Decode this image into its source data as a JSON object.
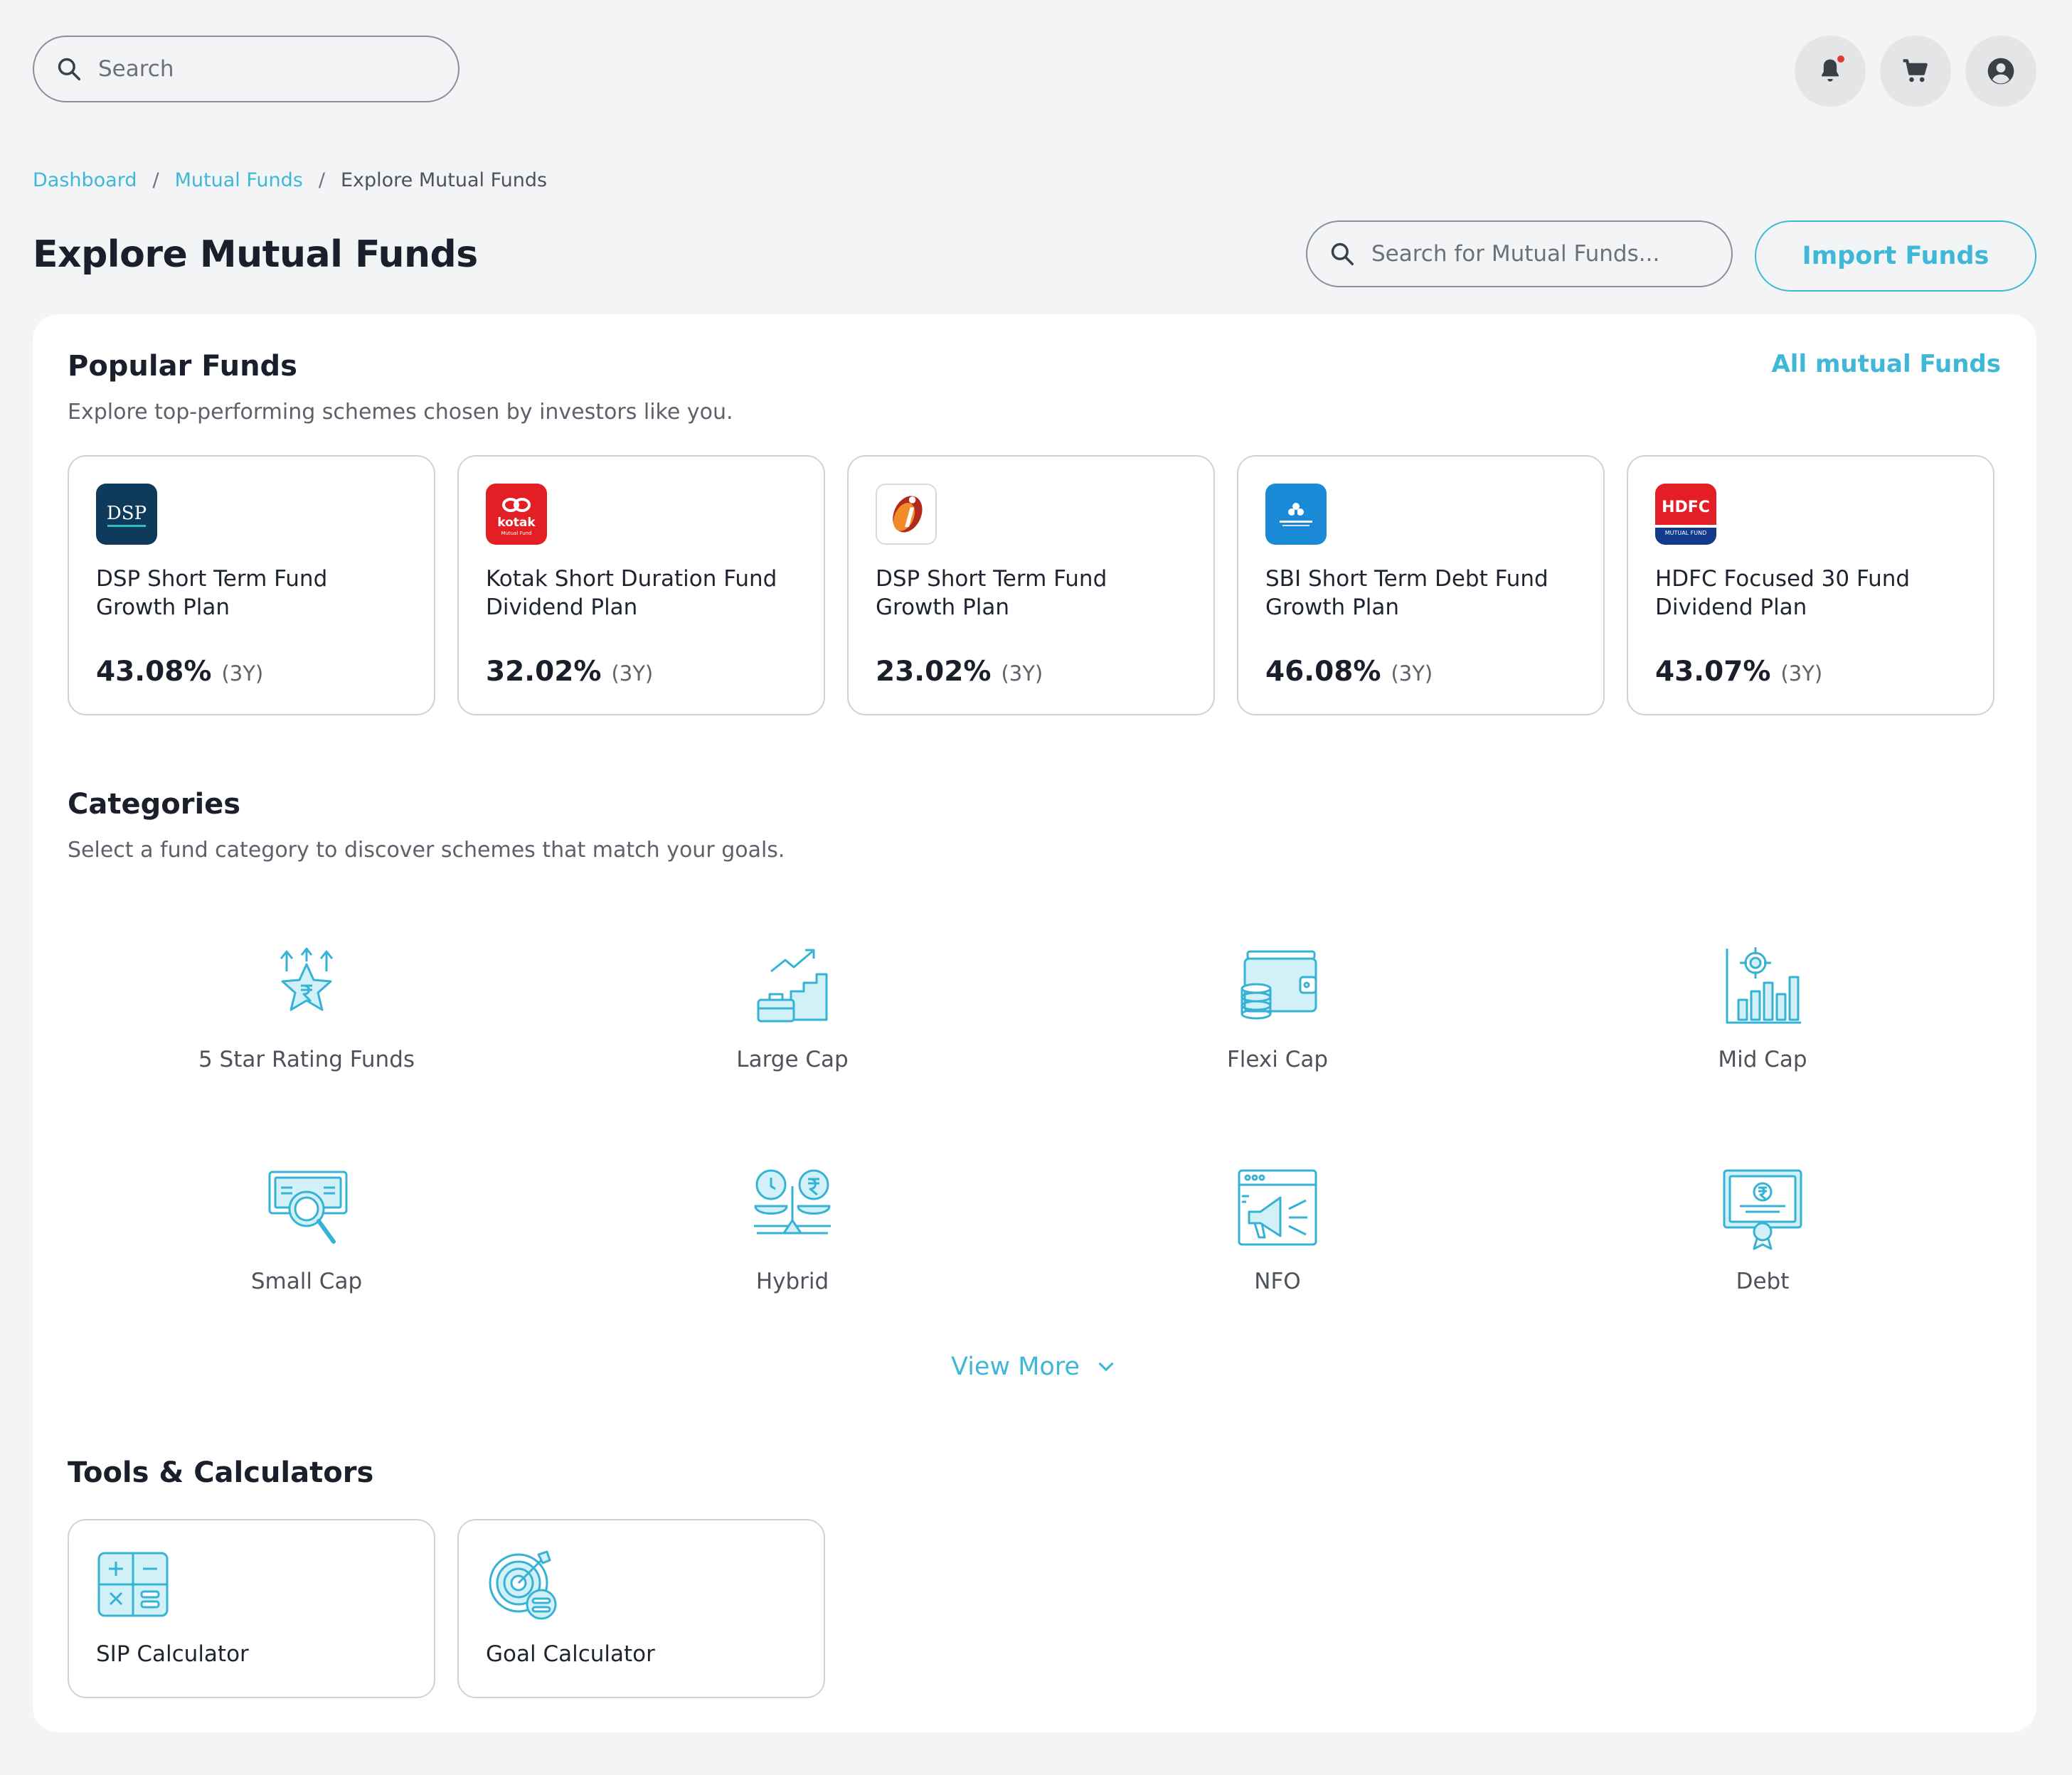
{
  "header": {
    "search_placeholder": "Search",
    "icons": [
      "bell-icon",
      "cart-icon",
      "user-icon"
    ]
  },
  "breadcrumb": {
    "items": [
      "Dashboard",
      "Mutual Funds",
      "Explore Mutual Funds"
    ],
    "separator": "/"
  },
  "page": {
    "title": "Explore Mutual Funds",
    "search_placeholder": "Search for Mutual Funds...",
    "import_label": "Import Funds"
  },
  "popular": {
    "title": "Popular Funds",
    "subtitle": "Explore top-performing schemes chosen by investors like you.",
    "all_link": "All mutual Funds",
    "funds": [
      {
        "logo": "DSP",
        "name_line1": "DSP Short Term Fund",
        "name_line2": "Growth Plan",
        "return": "43.08%",
        "period": "(3Y)"
      },
      {
        "logo": "kotak",
        "name_line1": "Kotak Short Duration Fund",
        "name_line2": "Dividend Plan",
        "return": "32.02%",
        "period": "(3Y)"
      },
      {
        "logo": "icici",
        "name_line1": "DSP Short Term Fund",
        "name_line2": "Growth Plan",
        "return": "23.02%",
        "period": "(3Y)"
      },
      {
        "logo": "sbi",
        "name_line1": "SBI Short Term Debt Fund",
        "name_line2": "Growth Plan",
        "return": "46.08%",
        "period": "(3Y)"
      },
      {
        "logo": "HDFC",
        "name_line1": "HDFC Focused 30 Fund",
        "name_line2": "Dividend Plan",
        "return": "43.07%",
        "period": "(3Y)"
      }
    ]
  },
  "categories": {
    "title": "Categories",
    "subtitle": "Select a fund category to discover schemes that match your goals.",
    "items": [
      {
        "label": "5 Star Rating Funds",
        "icon": "star-rupee-icon"
      },
      {
        "label": "Large Cap",
        "icon": "growth-chart-icon"
      },
      {
        "label": "Flexi Cap",
        "icon": "wallet-coins-icon"
      },
      {
        "label": "Mid Cap",
        "icon": "target-bar-chart-icon"
      },
      {
        "label": "Small Cap",
        "icon": "money-search-icon"
      },
      {
        "label": "Hybrid",
        "icon": "balance-scale-icon"
      },
      {
        "label": "NFO",
        "icon": "megaphone-window-icon"
      },
      {
        "label": "Debt",
        "icon": "certificate-icon"
      }
    ],
    "view_more": "View More"
  },
  "tools": {
    "title": "Tools & Calculators",
    "items": [
      {
        "label": "SIP Calculator",
        "icon": "calculator-icon"
      },
      {
        "label": "Goal Calculator",
        "icon": "target-icon"
      }
    ]
  },
  "colors": {
    "accent": "#3fb7d7",
    "background": "#f3f4f6",
    "card": "#ffffff"
  }
}
